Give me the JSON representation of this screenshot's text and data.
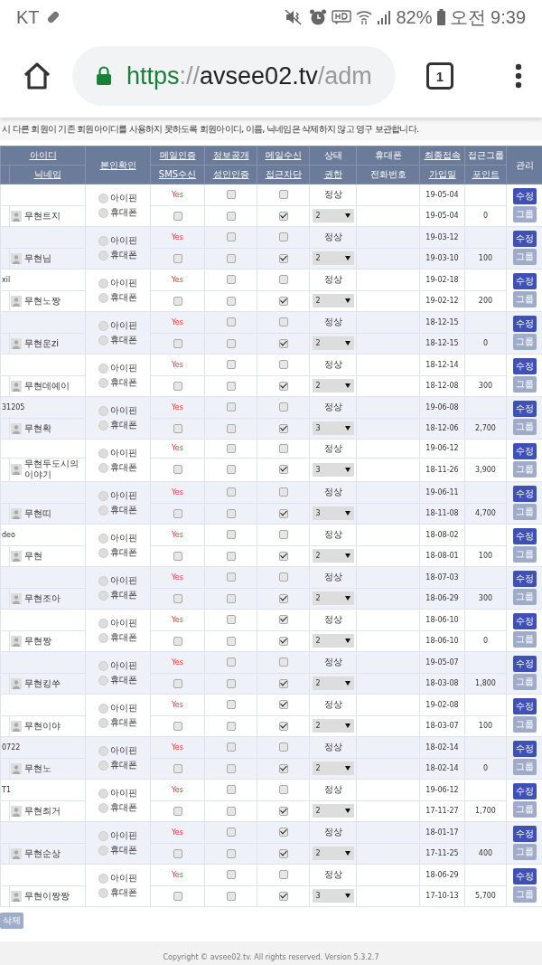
{
  "status_bar": {
    "carrier": "KT",
    "battery": "82%",
    "time": "오전 9:39"
  },
  "browser": {
    "url": {
      "scheme": "https",
      "separator": "://",
      "host": "avsee02.tv",
      "path": "/adm"
    },
    "tab_count": "1"
  },
  "notice": "시 다른 회원이 기존 회원아이디를 사용하지 못하도록 회원아이디, 이름, 닉네임은 삭제하지 않고 영구 보관합니다.",
  "header": {
    "top": [
      {
        "label": "아이디",
        "sortable": true
      },
      {
        "label": "메일인증",
        "sortable": true
      },
      {
        "label": "정보공개",
        "sortable": true
      },
      {
        "label": "메일수신",
        "sortable": true
      },
      {
        "label": "상태",
        "sortable": false
      },
      {
        "label": "휴대폰",
        "sortable": false
      },
      {
        "label": "최종접속",
        "sortable": true
      },
      {
        "label": "접근그룹",
        "sortable": false
      }
    ],
    "bottom": [
      {
        "label": "닉네임",
        "sortable": true
      },
      {
        "label": "SMS수신",
        "sortable": true
      },
      {
        "label": "성인인증",
        "sortable": true
      },
      {
        "label": "접근차단",
        "sortable": true
      },
      {
        "label": "권한",
        "sortable": true
      },
      {
        "label": "전화번호",
        "sortable": false
      },
      {
        "label": "가입일",
        "sortable": true
      },
      {
        "label": "포인트",
        "sortable": true
      }
    ],
    "verify": {
      "label": "본인확인",
      "sortable": true
    },
    "manage": {
      "label": "관리",
      "sortable": false
    }
  },
  "members": [
    {
      "nickname": "무현트지",
      "verify": [
        {
          "label": "아이핀",
          "selected": false
        },
        {
          "label": "휴대폰",
          "selected": false
        }
      ],
      "mail_cert": "Yes",
      "public": false,
      "mail_recv": false,
      "sms": false,
      "adult": false,
      "blocked": true,
      "status": "정상",
      "level": "2",
      "last_login": "19-05-04",
      "joined": "19-05-04",
      "points": "0",
      "edit": "수정",
      "group": "그룹"
    },
    {
      "nickname": "무현님",
      "verify": [
        {
          "label": "아이핀",
          "selected": false
        },
        {
          "label": "휴대폰",
          "selected": false
        }
      ],
      "mail_cert": "Yes",
      "public": false,
      "mail_recv": false,
      "sms": false,
      "adult": false,
      "blocked": true,
      "status": "정상",
      "level": "2",
      "last_login": "19-03-12",
      "joined": "19-03-10",
      "points": "100",
      "edit": "수정",
      "group": "그룹"
    },
    {
      "id": "xil",
      "nickname": "무현노짱",
      "verify": [
        {
          "label": "아이핀",
          "selected": false
        },
        {
          "label": "휴대폰",
          "selected": false
        }
      ],
      "mail_cert": "Yes",
      "public": false,
      "mail_recv": false,
      "sms": false,
      "adult": false,
      "blocked": true,
      "status": "정상",
      "level": "2",
      "last_login": "19-02-18",
      "joined": "19-02-12",
      "points": "200",
      "edit": "수정",
      "group": "그룹"
    },
    {
      "nickname": "무현운zi",
      "verify": [
        {
          "label": "아이핀",
          "selected": false
        },
        {
          "label": "휴대폰",
          "selected": false
        }
      ],
      "mail_cert": "Yes",
      "public": false,
      "mail_recv": false,
      "sms": false,
      "adult": false,
      "blocked": true,
      "status": "정상",
      "level": "2",
      "last_login": "18-12-15",
      "joined": "18-12-15",
      "points": "0",
      "edit": "수정",
      "group": "그룹"
    },
    {
      "nickname": "무현데예이",
      "verify": [
        {
          "label": "아이핀",
          "selected": false
        },
        {
          "label": "휴대폰",
          "selected": false
        }
      ],
      "mail_cert": "Yes",
      "public": false,
      "mail_recv": false,
      "sms": false,
      "adult": false,
      "blocked": true,
      "status": "정상",
      "level": "2",
      "last_login": "18-12-14",
      "joined": "18-12-08",
      "points": "300",
      "edit": "수정",
      "group": "그룹"
    },
    {
      "id": "31205",
      "nickname": "무현확",
      "verify": [
        {
          "label": "아이핀",
          "selected": false
        },
        {
          "label": "휴대폰",
          "selected": false
        }
      ],
      "mail_cert": "Yes",
      "public": false,
      "mail_recv": false,
      "sms": false,
      "adult": false,
      "blocked": true,
      "status": "정상",
      "level": "3",
      "last_login": "19-06-08",
      "joined": "18-12-06",
      "points": "2,700",
      "edit": "수정",
      "group": "그룹"
    },
    {
      "nickname": "무현두도시의 이야기",
      "verify": [
        {
          "label": "아이핀",
          "selected": false
        },
        {
          "label": "휴대폰",
          "selected": false
        }
      ],
      "mail_cert": "Yes",
      "public": false,
      "mail_recv": false,
      "sms": false,
      "adult": false,
      "blocked": true,
      "status": "정상",
      "level": "3",
      "last_login": "19-06-12",
      "joined": "18-11-26",
      "points": "3,900",
      "edit": "수정",
      "group": "그룹"
    },
    {
      "nickname": "무현띠",
      "verify": [
        {
          "label": "아이핀",
          "selected": false
        },
        {
          "label": "휴대폰",
          "selected": false
        }
      ],
      "mail_cert": "Yes",
      "public": false,
      "mail_recv": false,
      "sms": false,
      "adult": false,
      "blocked": true,
      "status": "정상",
      "level": "3",
      "last_login": "19-06-11",
      "joined": "18-11-08",
      "points": "4,700",
      "edit": "수정",
      "group": "그룹"
    },
    {
      "id": "deo",
      "nickname": "무현",
      "verify": [
        {
          "label": "아이핀",
          "selected": false
        },
        {
          "label": "휴대폰",
          "selected": false
        }
      ],
      "mail_cert": "Yes",
      "public": false,
      "mail_recv": false,
      "sms": false,
      "adult": false,
      "blocked": true,
      "status": "정상",
      "level": "2",
      "last_login": "18-08-02",
      "joined": "18-08-01",
      "points": "100",
      "edit": "수정",
      "group": "그룹"
    },
    {
      "nickname": "무현조아",
      "verify": [
        {
          "label": "아이핀",
          "selected": false
        },
        {
          "label": "휴대폰",
          "selected": false
        }
      ],
      "mail_cert": "Yes",
      "public": false,
      "mail_recv": false,
      "sms": false,
      "adult": false,
      "blocked": true,
      "status": "정상",
      "level": "2",
      "last_login": "18-07-03",
      "joined": "18-06-29",
      "points": "300",
      "edit": "수정",
      "group": "그룹"
    },
    {
      "nickname": "무현짱",
      "verify": [
        {
          "label": "아이핀",
          "selected": false
        },
        {
          "label": "휴대폰",
          "selected": false
        }
      ],
      "mail_cert": "Yes",
      "public": false,
      "mail_recv": true,
      "sms": false,
      "adult": false,
      "blocked": true,
      "status": "정상",
      "level": "2",
      "last_login": "18-06-10",
      "joined": "18-06-10",
      "points": "0",
      "edit": "수정",
      "group": "그룹"
    },
    {
      "nickname": "무현킹쑤",
      "verify": [
        {
          "label": "아이핀",
          "selected": false
        },
        {
          "label": "휴대폰",
          "selected": false
        }
      ],
      "mail_cert": "Yes",
      "public": false,
      "mail_recv": false,
      "sms": false,
      "adult": false,
      "blocked": true,
      "status": "정상",
      "level": "2",
      "last_login": "19-05-07",
      "joined": "18-03-08",
      "points": "1,800",
      "edit": "수정",
      "group": "그룹"
    },
    {
      "nickname": "무현이야",
      "verify": [
        {
          "label": "아이핀",
          "selected": false
        },
        {
          "label": "휴대폰",
          "selected": false
        }
      ],
      "mail_cert": "Yes",
      "public": false,
      "mail_recv": true,
      "sms": false,
      "adult": false,
      "blocked": true,
      "status": "정상",
      "level": "2",
      "last_login": "19-02-08",
      "joined": "18-03-07",
      "points": "100",
      "edit": "수정",
      "group": "그룹"
    },
    {
      "id": "0722",
      "nickname": "무현노",
      "verify": [
        {
          "label": "아이핀",
          "selected": false
        },
        {
          "label": "휴대폰",
          "selected": false
        }
      ],
      "mail_cert": "Yes",
      "public": false,
      "mail_recv": false,
      "sms": false,
      "adult": false,
      "blocked": true,
      "status": "정상",
      "level": "2",
      "last_login": "18-02-14",
      "joined": "18-02-14",
      "points": "0",
      "edit": "수정",
      "group": "그룹"
    },
    {
      "id": "T1",
      "nickname": "무현최거",
      "verify": [
        {
          "label": "아이핀",
          "selected": false
        },
        {
          "label": "휴대폰",
          "selected": false
        }
      ],
      "mail_cert": "Yes",
      "public": false,
      "mail_recv": false,
      "sms": false,
      "adult": false,
      "blocked": true,
      "status": "정상",
      "level": "2",
      "last_login": "19-06-12",
      "joined": "17-11-27",
      "points": "1,700",
      "edit": "수정",
      "group": "그룹"
    },
    {
      "nickname": "무현순상",
      "verify": [
        {
          "label": "아이핀",
          "selected": false
        },
        {
          "label": "휴대폰",
          "selected": false
        }
      ],
      "mail_cert": "Yes",
      "public": false,
      "mail_recv": true,
      "sms": false,
      "adult": false,
      "blocked": true,
      "status": "정상",
      "level": "2",
      "last_login": "18-01-17",
      "joined": "17-11-25",
      "points": "400",
      "edit": "수정",
      "group": "그룹"
    },
    {
      "nickname": "무현이짱짱",
      "verify": [
        {
          "label": "아이핀",
          "selected": false
        },
        {
          "label": "휴대폰",
          "selected": false
        }
      ],
      "mail_cert": "Yes",
      "public": false,
      "mail_recv": false,
      "sms": false,
      "adult": false,
      "blocked": true,
      "status": "정상",
      "level": "3",
      "last_login": "18-06-29",
      "joined": "17-10-13",
      "points": "5,700",
      "edit": "수정",
      "group": "그룹"
    }
  ],
  "delete_button": "삭제",
  "footer": "Copyright © avsee02.tv. All rights reserved. Version 5.3.2.7"
}
